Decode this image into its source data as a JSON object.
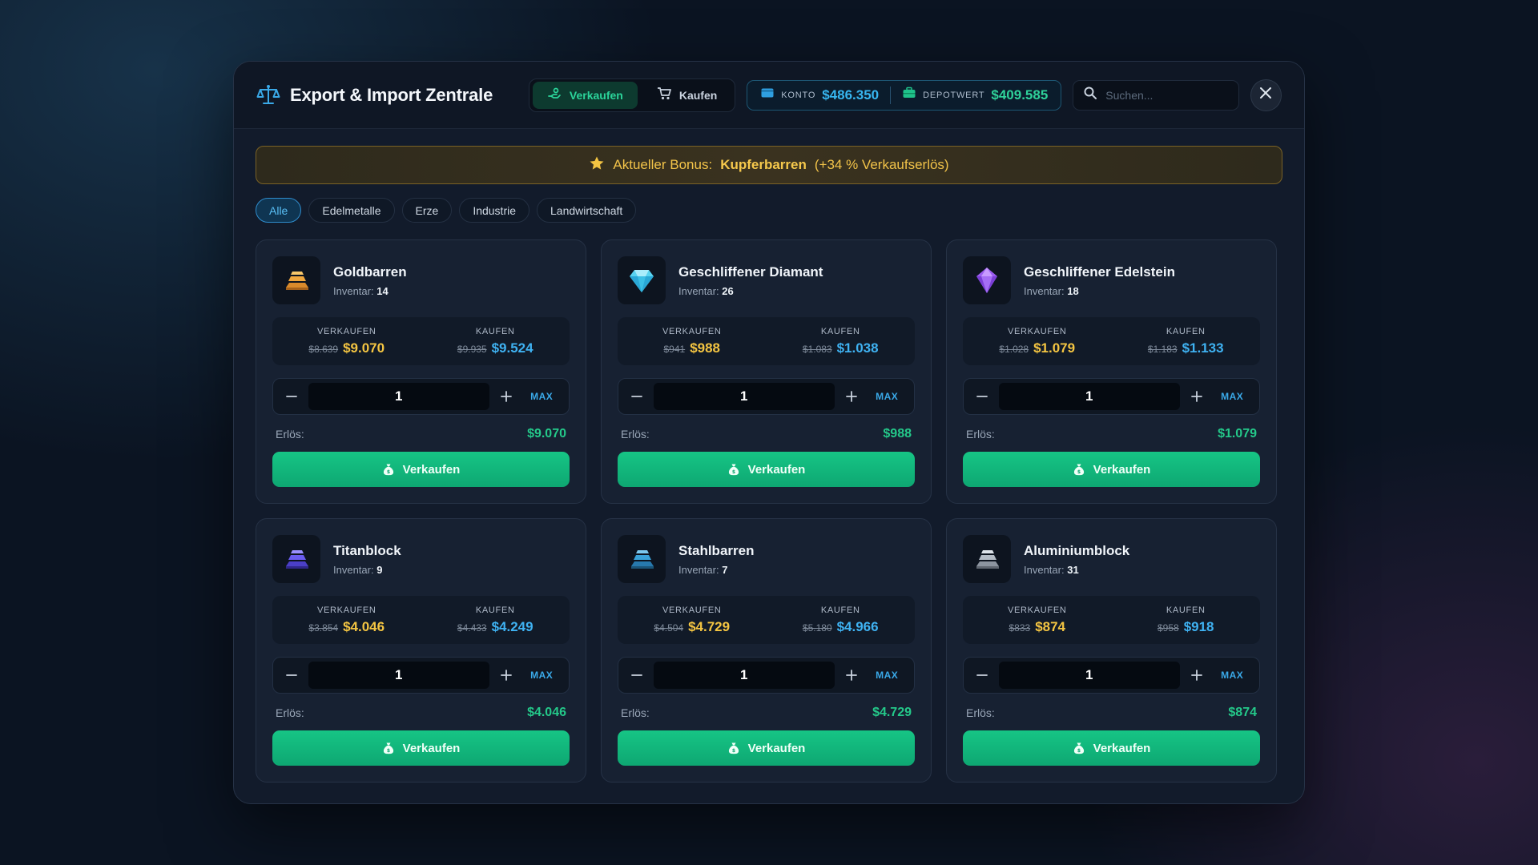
{
  "header": {
    "title": "Export & Import Zentrale",
    "mode": [
      {
        "label": "Verkaufen",
        "active": true
      },
      {
        "label": "Kaufen",
        "active": false
      }
    ],
    "konto_label": "KONTO",
    "konto_value": "$486.350",
    "depot_label": "DEPOTWERT",
    "depot_value": "$409.585",
    "search_placeholder": "Suchen..."
  },
  "bonus": {
    "prefix": "Aktueller Bonus:",
    "item": "Kupferbarren",
    "suffix": "(+34 % Verkaufserlös)"
  },
  "filters": [
    "Alle",
    "Edelmetalle",
    "Erze",
    "Industrie",
    "Landwirtschaft"
  ],
  "active_filter": "Alle",
  "labels": {
    "inventory": "Inventar:",
    "sell": "VERKAUFEN",
    "buy": "KAUFEN",
    "max": "MAX",
    "proceeds": "Erlös:",
    "sell_button": "Verkaufen"
  },
  "colors": {
    "accent_green": "#16c585",
    "accent_blue": "#3fb2f2",
    "accent_gold": "#f4c542"
  },
  "items": [
    {
      "name": "Goldbarren",
      "icon": "gold-bar-icon",
      "inventory": "14",
      "sell_old": "$8.639",
      "sell_new": "$9.070",
      "buy_old": "$9.935",
      "buy_new": "$9.524",
      "qty": "1",
      "proceeds": "$9.070"
    },
    {
      "name": "Geschliffener Diamant",
      "icon": "diamond-icon",
      "inventory": "26",
      "sell_old": "$941",
      "sell_new": "$988",
      "buy_old": "$1.083",
      "buy_new": "$1.038",
      "qty": "1",
      "proceeds": "$988"
    },
    {
      "name": "Geschliffener Edelstein",
      "icon": "gemstone-icon",
      "inventory": "18",
      "sell_old": "$1.028",
      "sell_new": "$1.079",
      "buy_old": "$1.183",
      "buy_new": "$1.133",
      "qty": "1",
      "proceeds": "$1.079"
    },
    {
      "name": "Titanblock",
      "icon": "titan-block-icon",
      "inventory": "9",
      "sell_old": "$3.854",
      "sell_new": "$4.046",
      "buy_old": "$4.433",
      "buy_new": "$4.249",
      "qty": "1",
      "proceeds": "$4.046"
    },
    {
      "name": "Stahlbarren",
      "icon": "steel-bar-icon",
      "inventory": "7",
      "sell_old": "$4.504",
      "sell_new": "$4.729",
      "buy_old": "$5.180",
      "buy_new": "$4.966",
      "qty": "1",
      "proceeds": "$4.729"
    },
    {
      "name": "Aluminiumblock",
      "icon": "aluminium-block-icon",
      "inventory": "31",
      "sell_old": "$833",
      "sell_new": "$874",
      "buy_old": "$958",
      "buy_new": "$918",
      "qty": "1",
      "proceeds": "$874"
    }
  ]
}
